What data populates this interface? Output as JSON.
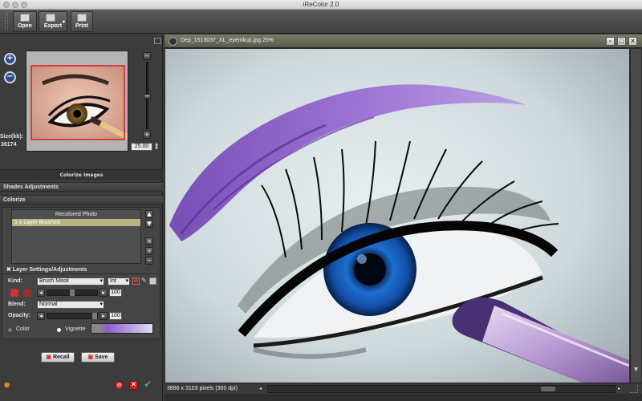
{
  "app": {
    "title": "iReColor 2.0"
  },
  "toolbar": {
    "open_label": "Open",
    "export_label": "Export",
    "print_label": "Print"
  },
  "preview": {
    "size_label": "Size(kb):",
    "size_value": "36174",
    "zoom_value": "25.00"
  },
  "panel": {
    "colorize_images_label": "Colorize Images",
    "shades_adjustments_label": "Shades Adjustments",
    "colorize_label": "Colorize",
    "layers": [
      {
        "label": "Recolored Photo"
      },
      {
        "label": "1   x  Layer Brushed"
      }
    ],
    "layer_settings_label": "Layer Settings/Adjustments",
    "kind_label": "Kind:",
    "kind_value": "Brush Mask",
    "kind_sub_value": "Int",
    "brush_value": "100",
    "blend_label": "Blend:",
    "blend_value": "Normal",
    "opacity_label": "Opacity:",
    "opacity_value": "100",
    "color_option_label": "Color",
    "vignette_option_label": "Vignette",
    "recall_label": "Recall",
    "save_label": "Save"
  },
  "document": {
    "title": "Dep_1513037_XL_eyemkup.jpg 25%",
    "status": "3886 x 3103 pixels (300 dpi)"
  },
  "colors": {
    "accent_layer": "#b7b483",
    "eyeshadow": "#8e5fc8",
    "iris": "#1d6fd0"
  }
}
